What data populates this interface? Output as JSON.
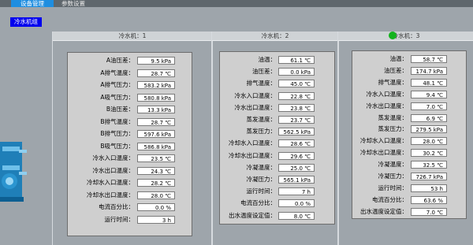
{
  "tabs": [
    {
      "label": "设备管理"
    },
    {
      "label": "参数设置"
    }
  ],
  "section_button": "冷水机组",
  "panels": [
    {
      "title": "冷水机：1",
      "rows": [
        {
          "label": "A油压差：",
          "value": "9.5 kPa"
        },
        {
          "label": "A排气温度：",
          "value": "28.7 ℃"
        },
        {
          "label": "A排气压力：",
          "value": "583.2 kPa"
        },
        {
          "label": "A吸气压力：",
          "value": "580.8 kPa"
        },
        {
          "label": "B油压差：",
          "value": "13.3 kPa"
        },
        {
          "label": "B排气温度：",
          "value": "28.7 ℃"
        },
        {
          "label": "B排气压力：",
          "value": "597.6 kPa"
        },
        {
          "label": "B吸气压力：",
          "value": "586.8 kPa"
        },
        {
          "label": "冷水入口温度：",
          "value": "23.5 ℃"
        },
        {
          "label": "冷水出口温度：",
          "value": "24.3 ℃"
        },
        {
          "label": "冷却水入口温度：",
          "value": "28.2 ℃"
        },
        {
          "label": "冷却水出口温度：",
          "value": "28.0 ℃"
        },
        {
          "label": "电流百分比：",
          "value": "0.0 %"
        },
        {
          "label": "运行时间：",
          "value": "3 h"
        }
      ]
    },
    {
      "title": "冷水机：2",
      "rows": [
        {
          "label": "油温：",
          "value": "61.1 ℃"
        },
        {
          "label": "油压差：",
          "value": "0.0 kPa"
        },
        {
          "label": "排气温度：",
          "value": "45.0 ℃"
        },
        {
          "label": "冷水入口温度：",
          "value": "22.8 ℃"
        },
        {
          "label": "冷水出口温度：",
          "value": "23.8 ℃"
        },
        {
          "label": "蒸发温度：",
          "value": "23.7 ℃"
        },
        {
          "label": "蒸发压力：",
          "value": "562.5 kPa"
        },
        {
          "label": "冷却水入口温度：",
          "value": "28.6 ℃"
        },
        {
          "label": "冷却水出口温度：",
          "value": "29.6 ℃"
        },
        {
          "label": "冷凝温度：",
          "value": "25.0 ℃"
        },
        {
          "label": "冷凝压力：",
          "value": "565.1 kPa"
        },
        {
          "label": "运行时间：",
          "value": "7 h"
        },
        {
          "label": "电流百分比：",
          "value": "0.0 %"
        },
        {
          "label": "出水温度设定值：",
          "value": "8.0 ℃"
        }
      ]
    },
    {
      "title": "冷水机：3",
      "status_color": "#13b31e",
      "rows": [
        {
          "label": "油温：",
          "value": "58.7 ℃"
        },
        {
          "label": "油压差：",
          "value": "174.7 kPa"
        },
        {
          "label": "排气温度：",
          "value": "48.1 ℃"
        },
        {
          "label": "冷水入口温度：",
          "value": "9.4 ℃"
        },
        {
          "label": "冷水出口温度：",
          "value": "7.0 ℃"
        },
        {
          "label": "蒸发温度：",
          "value": "6.9 ℃"
        },
        {
          "label": "蒸发压力：",
          "value": "279.5 kPa"
        },
        {
          "label": "冷却水入口温度：",
          "value": "28.0 ℃"
        },
        {
          "label": "冷却水出口温度：",
          "value": "30.2 ℃"
        },
        {
          "label": "冷凝温度：",
          "value": "32.5 ℃"
        },
        {
          "label": "冷凝压力：",
          "value": "726.7 kPa"
        },
        {
          "label": "运行时间：",
          "value": "53 h"
        },
        {
          "label": "电流百分比：",
          "value": "63.6 %"
        },
        {
          "label": "出水温度设定值：",
          "value": "7.0 ℃"
        }
      ]
    }
  ]
}
